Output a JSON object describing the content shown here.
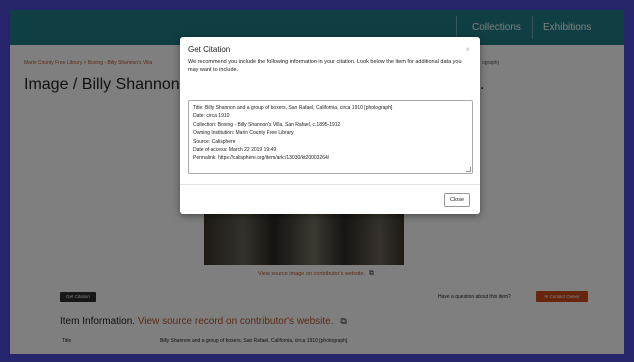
{
  "nav": {
    "items": [
      "Collections",
      "Exhibitions"
    ]
  },
  "breadcrumb": {
    "left": "Marin County Free Library > Boxing - Billy Shannon's Villa",
    "right": "ograph)"
  },
  "page": {
    "title": "Image / Billy Shannon and a",
    "title_tail": "."
  },
  "main": {
    "view_source": "View source image on contributor's website.",
    "get_citation": "Get Citation",
    "question": "Have a question about this item?",
    "contact_owner": "Contact Owner",
    "item_info_heading": "Item Information.",
    "item_info_link": "View source record on contributor's website.",
    "info_row_label": "Title",
    "info_row_value": "Billy Shannon and a group of boxers, San Rafael, California, circa 1910 [photograph]"
  },
  "modal": {
    "title": "Get Citation",
    "close_x": "×",
    "description": "We recommend you include the following information in your citation. Look below the item for additional data you may want to include.",
    "citation_lines": [
      "Title: Billy Shannon and a group of boxers, San Rafael, California, circa 1910 [photograph]",
      "Date: circa 1910",
      "Collection: Boxing - Billy Shannon's Villa, San Rafael, c.1895-1912",
      "Owning Institution: Marin County Free Library",
      "Source: Calisphere",
      "Date of access: March 22 2019 19:49",
      "Permalink: https://calisphere.org/item/ark:/13030/kt20003264/"
    ],
    "close_button": "Close"
  },
  "colors": {
    "frame": "#26246b",
    "nav_bg": "#1f7f87",
    "accent_orange": "#d04a1d",
    "link": "#b5532a"
  }
}
